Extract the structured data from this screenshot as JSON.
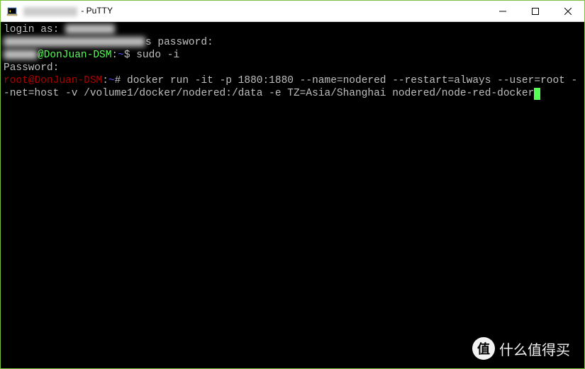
{
  "window": {
    "title_suffix": "- PuTTY"
  },
  "terminal": {
    "login_prompt": "login as: ",
    "password_suffix": "s password:",
    "user_prompt": {
      "at": "@",
      "host": "DonJuan-DSM",
      "colon": ":",
      "path": "~",
      "sigil": "$"
    },
    "sudo_cmd": " sudo -i",
    "password_prompt": "Password:",
    "root_prompt": {
      "user": "root",
      "at": "@",
      "host": "DonJuan-DSM",
      "colon": ":",
      "path": "~",
      "sigil": "#"
    },
    "docker_cmd": " docker run -it -p 1880:1880 --name=nodered --restart=always --user=root --net=host -v /volume1/docker/nodered:/data -e TZ=Asia/Shanghai nodered/node-red-docker"
  },
  "watermark": {
    "badge": "值",
    "text": "什么值得买"
  }
}
